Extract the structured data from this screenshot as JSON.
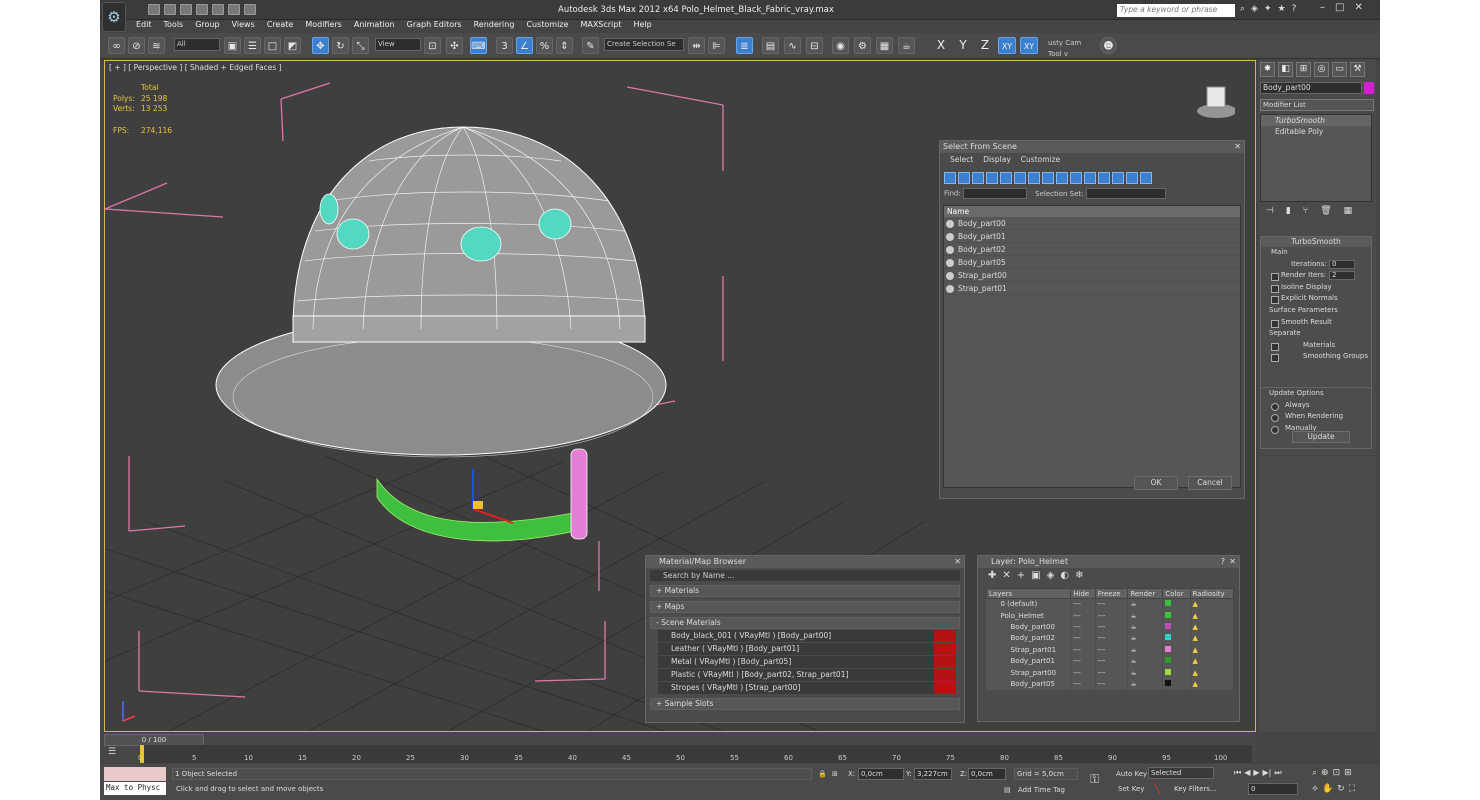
{
  "app": {
    "title": "Autodesk 3ds Max  2012 x64     Polo_Helmet_Black_Fabric_vray.max",
    "search_placeholder": "Type a keyword or phrase"
  },
  "menu": [
    "Edit",
    "Tools",
    "Group",
    "Views",
    "Create",
    "Modifiers",
    "Animation",
    "Graph Editors",
    "Rendering",
    "Customize",
    "MAXScript",
    "Help"
  ],
  "toolbar": {
    "filter": "All",
    "refcoord": "View",
    "selection_set": "Create Selection Se",
    "axes": [
      "X",
      "Y",
      "Z",
      "XY",
      "XY"
    ],
    "camtool": "usty Cam Tool v"
  },
  "viewport": {
    "label": "[ + ] [ Perspective ] [ Shaded + Edged Faces ]",
    "stats_header": "Total",
    "polys_label": "Polys:",
    "polys_value": "25 198",
    "verts_label": "Verts:",
    "verts_value": "13 253",
    "fps_label": "FPS:",
    "fps_value": "274,116"
  },
  "select_from_scene": {
    "title": "Select From Scene",
    "menu": [
      "Select",
      "Display",
      "Customize"
    ],
    "find_label": "Find:",
    "selection_set_label": "Selection Set:",
    "column": "Name",
    "items": [
      "Body_part00",
      "Body_part01",
      "Body_part02",
      "Body_part05",
      "Strap_part00",
      "Strap_part01"
    ],
    "ok": "OK",
    "cancel": "Cancel"
  },
  "material_browser": {
    "title": "Material/Map Browser",
    "search": "Search by Name ...",
    "groups": [
      "+ Materials",
      "+ Maps",
      "- Scene Materials",
      "+ Sample Slots"
    ],
    "materials": [
      "Body_black_001  ( VRayMtl )  [Body_part00]",
      "Leather  ( VRayMtl )  [Body_part01]",
      "Metal  ( VRayMtl )  [Body_part05]",
      "Plastic  ( VRayMtl )  [Body_part02, Strap_part01]",
      "Stropes  ( VRayMtl )  [Strap_part00]"
    ]
  },
  "layer_manager": {
    "title": "Layer: Polo_Helmet",
    "columns": [
      "Layers",
      "Hide",
      "Freeze",
      "Render",
      "Color",
      "Radiosity"
    ],
    "rows": [
      {
        "name": "0 (default)",
        "color": "#3fbf3f"
      },
      {
        "name": "Polo_Helmet",
        "color": "#3fbf3f"
      },
      {
        "name": "Body_part00",
        "color": "#b84fb8"
      },
      {
        "name": "Body_part02",
        "color": "#2ad4c8"
      },
      {
        "name": "Strap_part01",
        "color": "#e47fd6"
      },
      {
        "name": "Body_part01",
        "color": "#2c9a2c"
      },
      {
        "name": "Strap_part00",
        "color": "#9edc3a"
      },
      {
        "name": "Body_part05",
        "color": "#111111"
      }
    ]
  },
  "command_panel": {
    "object_name": "Body_part00",
    "modifier_list": "Modifier List",
    "stack": [
      "TurboSmooth",
      "Editable Poly"
    ],
    "turbosmooth": {
      "title": "TurboSmooth",
      "main": "Main",
      "iterations_label": "Iterations:",
      "iterations": "0",
      "render_iters_label": "Render Iters:",
      "render_iters": "2",
      "isoline": "Isoline Display",
      "explicit": "Explicit Normals",
      "surface_params": "Surface Parameters",
      "smooth_result": "Smooth Result",
      "separate": "Separate",
      "materials": "Materials",
      "smoothing_groups": "Smoothing Groups",
      "update_options": "Update Options",
      "always": "Always",
      "when_rendering": "When Rendering",
      "manually": "Manually",
      "update": "Update"
    }
  },
  "timeline": {
    "frame": "0 / 100",
    "ticks": [
      "0",
      "5",
      "10",
      "15",
      "20",
      "25",
      "30",
      "35",
      "40",
      "45",
      "50",
      "55",
      "60",
      "65",
      "70",
      "75",
      "80",
      "85",
      "90",
      "95",
      "100"
    ]
  },
  "status": {
    "maxscript": "Max to Physc",
    "selected": "1 Object Selected",
    "prompt": "Click and drag to select and move objects",
    "x_label": "X:",
    "x": "0,0cm",
    "y_label": "Y:",
    "y": "3,227cm",
    "z_label": "Z:",
    "z": "0,0cm",
    "grid": "Grid = 5,0cm",
    "add_time_tag": "Add Time Tag",
    "auto_key": "Auto Key",
    "key_mode": "Selected",
    "set_key": "Set Key",
    "key_filters": "Key Filters...",
    "frame": "0"
  }
}
